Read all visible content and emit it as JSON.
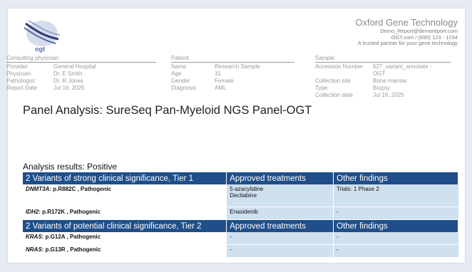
{
  "header": {
    "logo_text": "ogt",
    "company_name": "Oxford Gene Technology",
    "email": "Demo_Report@demoreport.com",
    "contact": "OGT.com / (650) 123 - 1234",
    "tagline": "A trusted partner for your gene technology"
  },
  "consulting": {
    "heading": "Consulting physician",
    "rows": [
      {
        "k": "Provider",
        "v": "General Hospital"
      },
      {
        "k": "Physician",
        "v": "Dr. E Smith"
      },
      {
        "k": "Pathologist",
        "v": "Dr. R Jones"
      },
      {
        "k": "Report Date",
        "v": "Jul 16, 2025"
      }
    ]
  },
  "patient": {
    "heading": "Patient",
    "rows": [
      {
        "k": "Name",
        "v": "Research Sample"
      },
      {
        "k": "Age",
        "v": "31"
      },
      {
        "k": "Gender",
        "v": "Female"
      },
      {
        "k": "Diagnosis",
        "v": "AML"
      }
    ]
  },
  "sample": {
    "heading": "Sample",
    "accession_label": "Accession Number",
    "accession_value": "627_variant_annotate -",
    "accession_value2": "OGT",
    "rows": [
      {
        "k": "Collection site",
        "v": "Bone marrow"
      },
      {
        "k": "Type",
        "v": "Biopsy"
      },
      {
        "k": "Collection date",
        "v": "Jul 16, 2025"
      }
    ]
  },
  "title": "Panel Analysis: SureSeq Pan-Myeloid NGS Panel-OGT",
  "results_heading": "Analysis results: Positive",
  "tier1": {
    "col1": "2 Variants of strong clinical significance, Tier 1",
    "col2": "Approved treatments",
    "col3": "Other findings",
    "rows": [
      {
        "gene": "DNMT3A",
        "variant": ": p.R882C , Pathogenic",
        "treat1": "5-azacytidine",
        "treat2": "Decitabine",
        "other": "Trials: 1 Phase 2"
      },
      {
        "gene": "IDH2",
        "variant": ": p.R172K , Pathogenic",
        "treat1": "Enasidenib",
        "treat2": "",
        "other": "-"
      }
    ]
  },
  "tier2": {
    "col1": "2 Variants of potential clinical significance, Tier 2",
    "col2": "Approved treatments",
    "col3": "Other findings",
    "rows": [
      {
        "gene": "KRAS",
        "variant": ": p.G12A , Pathogenic",
        "treat1": "-",
        "other": "-"
      },
      {
        "gene": "NRAS",
        "variant": ": p.G13R , Pathogenic",
        "treat1": "-",
        "other": "-"
      }
    ]
  }
}
